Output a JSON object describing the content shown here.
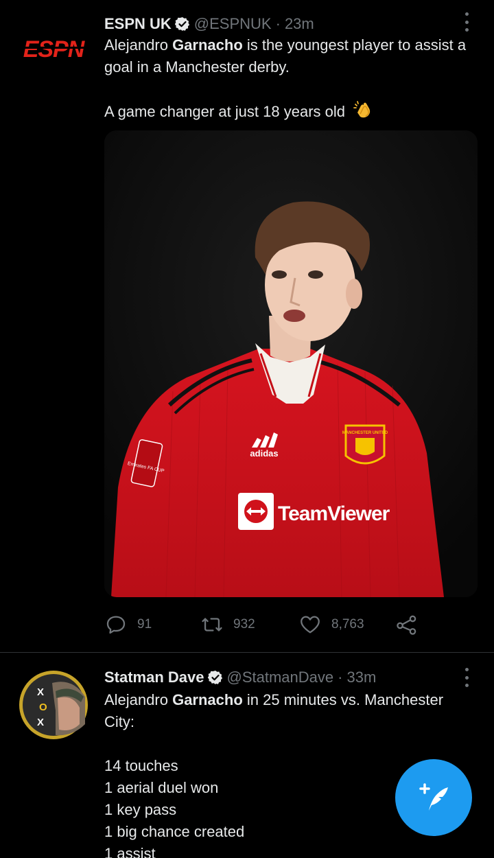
{
  "tweets": [
    {
      "author": {
        "name": "ESPN UK",
        "handle": "@ESPNUK",
        "time": "23m",
        "verified": true,
        "avatar_logo": "ESPN"
      },
      "text_segments": {
        "p1": "Alejandro ",
        "p1_bold": "Garnacho",
        "p1_rest": " is the youngest player to assist a goal in a Manchester derby.",
        "p2": "A game changer at just 18 years old",
        "p2_emoji": "clapping-hands-emoji"
      },
      "media": {
        "type": "photo",
        "description_icon": "player-photo",
        "badge_text": "TeamViewer",
        "kit_brand": "adidas",
        "crest": "MANCHESTER UNITED",
        "sleeve_patch": "Emirates FA CUP"
      },
      "stats": {
        "replies": "91",
        "retweets": "932",
        "likes": "8,763"
      }
    },
    {
      "author": {
        "name": "Statman Dave",
        "handle": "@StatmanDave",
        "time": "33m",
        "verified": true
      },
      "text_segments": {
        "p1": "Alejandro ",
        "p1_bold": "Garnacho",
        "p1_rest": " in 25 minutes vs. Manchester City:",
        "stats_lines": [
          "14 touches",
          "1 aerial duel won",
          "1 key pass",
          "1 big chance created",
          "1 assist"
        ]
      }
    }
  ],
  "icons": {
    "reply": "reply-icon",
    "retweet": "retweet-icon",
    "like": "heart-icon",
    "share": "share-icon",
    "more": "more-icon",
    "verified": "verified-badge-icon",
    "compose": "compose-tweet-icon"
  },
  "colors": {
    "background": "#000000",
    "text": "#e7e9ea",
    "muted": "#71767b",
    "divider": "#2f3336",
    "accent": "#1d9bf0",
    "espn_red": "#e2231a",
    "united_red": "#d0121b"
  }
}
